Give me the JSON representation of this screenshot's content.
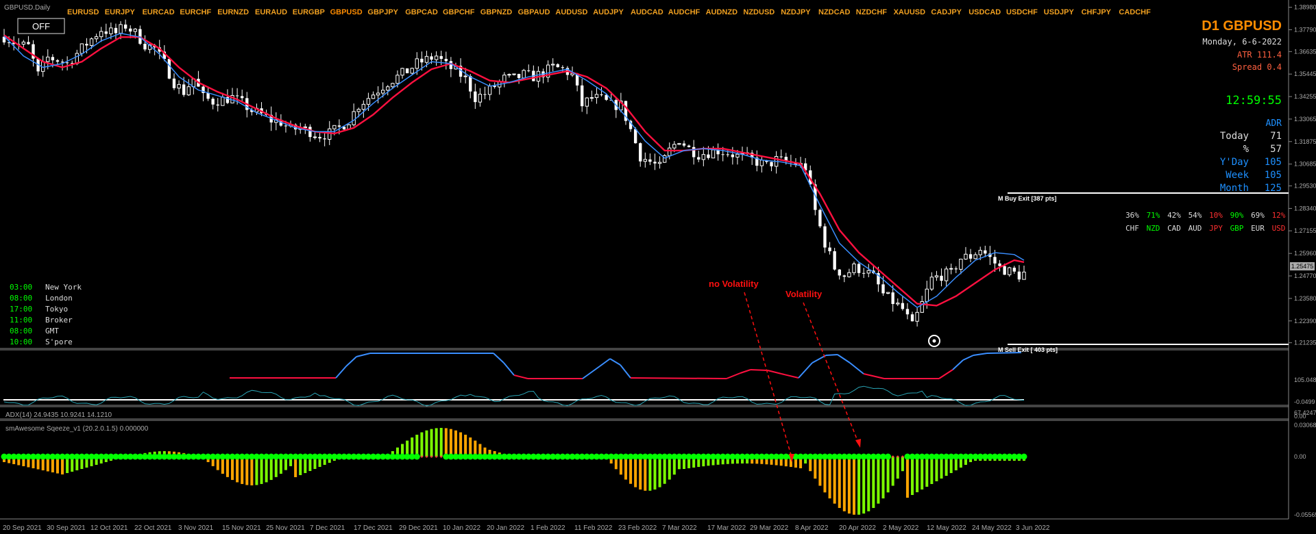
{
  "window_title": "GBPUSD.Daily",
  "off_button": "OFF",
  "symbols": [
    "EURUSD",
    "EURJPY",
    "EURCAD",
    "EURCHF",
    "EURNZD",
    "EURAUD",
    "EURGBP",
    "GBPUSD",
    "GBPJPY",
    "GBPCAD",
    "GBPCHF",
    "GBPNZD",
    "GBPAUD",
    "AUDUSD",
    "AUDJPY",
    "AUDCAD",
    "AUDCHF",
    "AUDNZD",
    "NZDUSD",
    "NZDJPY",
    "NZDCAD",
    "NZDCHF",
    "XAUUSD",
    "CADJPY",
    "USDCAD",
    "USDCHF",
    "USDJPY",
    "CHFJPY",
    "CADCHF"
  ],
  "active_symbol": "GBPUSD",
  "colors": {
    "symbol": "#f0a020",
    "active_symbol": "#ff8c00",
    "bull": "#ffffff",
    "ma_fast": "#3a8eff",
    "ma_slow": "#ff1040",
    "green": "#00ff00",
    "orange": "#ffa500",
    "red": "#ff3030",
    "blue": "#1e90ff"
  },
  "info": {
    "title": "D1 GBPUSD",
    "date": "Monday, 6-6-2022",
    "atr": "ATR 111.4",
    "spread": "Spread 0.4",
    "clock": "12:59:55",
    "adr_label": "ADR",
    "adr_rows": [
      {
        "label": "Today",
        "value": "71",
        "color": "#dddddd"
      },
      {
        "label": "%",
        "value": "57",
        "color": "#dddddd"
      },
      {
        "label": "Y'Day",
        "value": "105",
        "color": "#1e90ff"
      },
      {
        "label": "Week",
        "value": "105",
        "color": "#1e90ff"
      },
      {
        "label": "Month",
        "value": "125",
        "color": "#1e90ff"
      }
    ]
  },
  "strength": [
    {
      "pct": "36%",
      "cur": "CHF",
      "color": "#dddddd"
    },
    {
      "pct": "71%",
      "cur": "NZD",
      "color": "#00ff00"
    },
    {
      "pct": "42%",
      "cur": "CAD",
      "color": "#dddddd"
    },
    {
      "pct": "54%",
      "cur": "AUD",
      "color": "#dddddd"
    },
    {
      "pct": "10%",
      "cur": "JPY",
      "color": "#ff3030"
    },
    {
      "pct": "90%",
      "cur": "GBP",
      "color": "#00ff00"
    },
    {
      "pct": "69%",
      "cur": "EUR",
      "color": "#dddddd"
    },
    {
      "pct": "12%",
      "cur": "USD",
      "color": "#ff3030"
    }
  ],
  "exit_lines": {
    "buy": "M Buy Exit [387 pts]",
    "sell": "M Sell Exit [ 403 pts]"
  },
  "sessions": [
    {
      "time": "03:00",
      "name": "New York"
    },
    {
      "time": "08:00",
      "name": "London"
    },
    {
      "time": "17:00",
      "name": "Tokyo"
    },
    {
      "time": "11:00",
      "name": "Broker"
    },
    {
      "time": "08:00",
      "name": "GMT"
    },
    {
      "time": "10:00",
      "name": "S'pore"
    }
  ],
  "annotations": {
    "no_volatility": "no Volatility",
    "volatility": "Volatility"
  },
  "price_axis": [
    "1.38980",
    "1.37790",
    "1.36635",
    "1.35445",
    "1.34255",
    "1.33065",
    "1.31875",
    "1.30685",
    "1.29530",
    "1.28340",
    "1.27155",
    "1.25960",
    "1.24770",
    "1.23580",
    "1.22390",
    "1.21235"
  ],
  "current_price": "1.25475",
  "indicator1": {
    "max": "105.0481",
    "min": "-0.0499"
  },
  "adx": {
    "label": "ADX(14) 24.9435 10.9241 14.1210",
    "max": "67.4247",
    "min": "0.00"
  },
  "squeeze": {
    "label": "smAwesome Sqeeze_v1 (20.2.0.1.5)  0.000000",
    "max": "0.030685",
    "zero": "0.00",
    "min": "-0.055651"
  },
  "dates": [
    "20 Sep 2021",
    "30 Sep 2021",
    "12 Oct 2021",
    "22 Oct 2021",
    "3 Nov 2021",
    "15 Nov 2021",
    "25 Nov 2021",
    "7 Dec 2021",
    "17 Dec 2021",
    "29 Dec 2021",
    "10 Jan 2022",
    "20 Jan 2022",
    "1 Feb 2022",
    "11 Feb 2022",
    "23 Feb 2022",
    "7 Mar 2022",
    "17 Mar 2022",
    "29 Mar 2022",
    "8 Apr 2022",
    "20 Apr 2022",
    "2 May 2022",
    "12 May 2022",
    "24 May 2022",
    "3 Jun 2022"
  ],
  "chart_data": {
    "type": "candlestick",
    "timeframe": "Daily",
    "symbol": "GBPUSD",
    "ylim": [
      1.2115,
      1.39
    ],
    "close_path": [
      [
        0,
        1.3742
      ],
      [
        3,
        1.37
      ],
      [
        5,
        1.369
      ],
      [
        7,
        1.354
      ],
      [
        9,
        1.363
      ],
      [
        11,
        1.362
      ],
      [
        13,
        1.36
      ],
      [
        16,
        1.368
      ],
      [
        18,
        1.373
      ],
      [
        20,
        1.378
      ],
      [
        23,
        1.376
      ],
      [
        25,
        1.38
      ],
      [
        27,
        1.376
      ],
      [
        29,
        1.37
      ],
      [
        31,
        1.368
      ],
      [
        33,
        1.36
      ],
      [
        35,
        1.35
      ],
      [
        37,
        1.345
      ],
      [
        39,
        1.352
      ],
      [
        41,
        1.342
      ],
      [
        43,
        1.34
      ],
      [
        45,
        1.341
      ],
      [
        47,
        1.342
      ],
      [
        49,
        1.339
      ],
      [
        51,
        1.335
      ],
      [
        53,
        1.333
      ],
      [
        55,
        1.33
      ],
      [
        57,
        1.329
      ],
      [
        59,
        1.325
      ],
      [
        61,
        1.326
      ],
      [
        63,
        1.324
      ],
      [
        65,
        1.322
      ],
      [
        67,
        1.323
      ],
      [
        69,
        1.326
      ],
      [
        71,
        1.33
      ],
      [
        73,
        1.338
      ],
      [
        75,
        1.342
      ],
      [
        77,
        1.346
      ],
      [
        79,
        1.35
      ],
      [
        81,
        1.353
      ],
      [
        83,
        1.356
      ],
      [
        85,
        1.36
      ],
      [
        87,
        1.362
      ],
      [
        89,
        1.364
      ],
      [
        91,
        1.359
      ],
      [
        93,
        1.356
      ],
      [
        95,
        1.352
      ],
      [
        97,
        1.342
      ],
      [
        99,
        1.344
      ],
      [
        101,
        1.348
      ],
      [
        103,
        1.352
      ],
      [
        105,
        1.352
      ],
      [
        107,
        1.354
      ],
      [
        109,
        1.353
      ],
      [
        111,
        1.355
      ],
      [
        113,
        1.358
      ],
      [
        115,
        1.357
      ],
      [
        117,
        1.354
      ],
      [
        119,
        1.338
      ],
      [
        121,
        1.342
      ],
      [
        123,
        1.341
      ],
      [
        125,
        1.338
      ],
      [
        127,
        1.338
      ],
      [
        129,
        1.325
      ],
      [
        131,
        1.311
      ],
      [
        133,
        1.308
      ],
      [
        135,
        1.305
      ],
      [
        137,
        1.314
      ],
      [
        139,
        1.32
      ],
      [
        141,
        1.315
      ],
      [
        143,
        1.312
      ],
      [
        145,
        1.313
      ],
      [
        147,
        1.314
      ],
      [
        149,
        1.313
      ],
      [
        151,
        1.311
      ],
      [
        153,
        1.31
      ],
      [
        155,
        1.308
      ],
      [
        157,
        1.306
      ],
      [
        159,
        1.309
      ],
      [
        161,
        1.308
      ],
      [
        163,
        1.307
      ],
      [
        165,
        1.305
      ],
      [
        167,
        1.282
      ],
      [
        169,
        1.265
      ],
      [
        171,
        1.252
      ],
      [
        173,
        1.248
      ],
      [
        175,
        1.252
      ],
      [
        177,
        1.251
      ],
      [
        179,
        1.247
      ],
      [
        181,
        1.238
      ],
      [
        183,
        1.234
      ],
      [
        185,
        1.23
      ],
      [
        187,
        1.221
      ],
      [
        189,
        1.233
      ],
      [
        191,
        1.246
      ],
      [
        193,
        1.248
      ],
      [
        195,
        1.249
      ],
      [
        197,
        1.257
      ],
      [
        199,
        1.258
      ],
      [
        201,
        1.262
      ],
      [
        203,
        1.257
      ],
      [
        205,
        1.252
      ],
      [
        207,
        1.25
      ],
      [
        209,
        1.248
      ],
      [
        210,
        1.249
      ]
    ],
    "ma_fast_path": [
      [
        0,
        1.3745
      ],
      [
        4,
        1.364
      ],
      [
        8,
        1.358
      ],
      [
        12,
        1.36
      ],
      [
        16,
        1.365
      ],
      [
        20,
        1.372
      ],
      [
        24,
        1.376
      ],
      [
        28,
        1.374
      ],
      [
        32,
        1.365
      ],
      [
        36,
        1.353
      ],
      [
        40,
        1.346
      ],
      [
        44,
        1.343
      ],
      [
        48,
        1.34
      ],
      [
        52,
        1.334
      ],
      [
        56,
        1.33
      ],
      [
        60,
        1.326
      ],
      [
        64,
        1.324
      ],
      [
        68,
        1.324
      ],
      [
        72,
        1.33
      ],
      [
        76,
        1.339
      ],
      [
        80,
        1.347
      ],
      [
        84,
        1.354
      ],
      [
        88,
        1.361
      ],
      [
        92,
        1.36
      ],
      [
        96,
        1.353
      ],
      [
        100,
        1.348
      ],
      [
        104,
        1.35
      ],
      [
        108,
        1.353
      ],
      [
        112,
        1.355
      ],
      [
        116,
        1.357
      ],
      [
        120,
        1.351
      ],
      [
        124,
        1.344
      ],
      [
        128,
        1.332
      ],
      [
        132,
        1.319
      ],
      [
        136,
        1.31
      ],
      [
        140,
        1.314
      ],
      [
        144,
        1.315
      ],
      [
        148,
        1.314
      ],
      [
        152,
        1.312
      ],
      [
        156,
        1.309
      ],
      [
        160,
        1.308
      ],
      [
        164,
        1.306
      ],
      [
        168,
        1.285
      ],
      [
        172,
        1.265
      ],
      [
        176,
        1.255
      ],
      [
        180,
        1.248
      ],
      [
        184,
        1.239
      ],
      [
        188,
        1.231
      ],
      [
        192,
        1.237
      ],
      [
        196,
        1.247
      ],
      [
        200,
        1.256
      ],
      [
        204,
        1.26
      ],
      [
        208,
        1.259
      ],
      [
        210,
        1.256
      ]
    ],
    "ma_slow_path": [
      [
        0,
        1.375
      ],
      [
        4,
        1.368
      ],
      [
        8,
        1.361
      ],
      [
        12,
        1.358
      ],
      [
        16,
        1.361
      ],
      [
        20,
        1.368
      ],
      [
        24,
        1.374
      ],
      [
        28,
        1.374
      ],
      [
        32,
        1.368
      ],
      [
        36,
        1.358
      ],
      [
        40,
        1.35
      ],
      [
        44,
        1.345
      ],
      [
        48,
        1.341
      ],
      [
        52,
        1.336
      ],
      [
        56,
        1.331
      ],
      [
        60,
        1.327
      ],
      [
        64,
        1.324
      ],
      [
        68,
        1.323
      ],
      [
        72,
        1.326
      ],
      [
        76,
        1.333
      ],
      [
        80,
        1.342
      ],
      [
        84,
        1.35
      ],
      [
        88,
        1.357
      ],
      [
        92,
        1.36
      ],
      [
        96,
        1.356
      ],
      [
        100,
        1.351
      ],
      [
        104,
        1.35
      ],
      [
        108,
        1.352
      ],
      [
        112,
        1.354
      ],
      [
        116,
        1.356
      ],
      [
        120,
        1.353
      ],
      [
        124,
        1.347
      ],
      [
        128,
        1.337
      ],
      [
        132,
        1.324
      ],
      [
        136,
        1.314
      ],
      [
        140,
        1.314
      ],
      [
        144,
        1.315
      ],
      [
        148,
        1.315
      ],
      [
        152,
        1.313
      ],
      [
        156,
        1.311
      ],
      [
        160,
        1.309
      ],
      [
        164,
        1.307
      ],
      [
        168,
        1.291
      ],
      [
        172,
        1.272
      ],
      [
        176,
        1.26
      ],
      [
        180,
        1.251
      ],
      [
        184,
        1.242
      ],
      [
        188,
        1.233
      ],
      [
        192,
        1.232
      ],
      [
        196,
        1.237
      ],
      [
        200,
        1.244
      ],
      [
        204,
        1.251
      ],
      [
        208,
        1.256
      ],
      [
        210,
        1.255
      ]
    ]
  }
}
